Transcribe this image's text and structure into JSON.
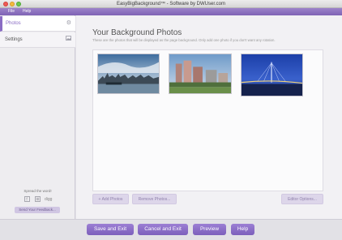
{
  "window": {
    "title": "EasyBigBackground™ - Software by DWUser.com"
  },
  "menu": {
    "items": [
      "File",
      "Help"
    ]
  },
  "sidebar": {
    "items": [
      {
        "label": "Photos",
        "icon": "gear-icon"
      },
      {
        "label": "Settings",
        "icon": "image-icon"
      }
    ],
    "spread_text": "Spread the word!",
    "share_icons": [
      "facebook-icon",
      "twitter-icon",
      "digg-icon"
    ],
    "share_digg_label": "digg",
    "feedback_label": "Send Your Feedback..."
  },
  "main": {
    "title": "Your Background Photos",
    "subtitle": "These are the photos that will be displayed as the page background.  Only add one photo if you don't want any rotation.",
    "photos": [
      {
        "name": "harbor-skyline-photo"
      },
      {
        "name": "riverside-buildings-photo"
      },
      {
        "name": "night-bridge-photo"
      }
    ],
    "buttons": {
      "add": "+ Add Photos",
      "remove": "Remove Photos...",
      "editor": "Editor Options..."
    }
  },
  "footer": {
    "save": "Save and Exit",
    "cancel": "Cancel and Exit",
    "preview": "Preview",
    "help": "Help"
  },
  "colors": {
    "accent": "#8a6cc4",
    "menubar": "#8a6fc0"
  }
}
